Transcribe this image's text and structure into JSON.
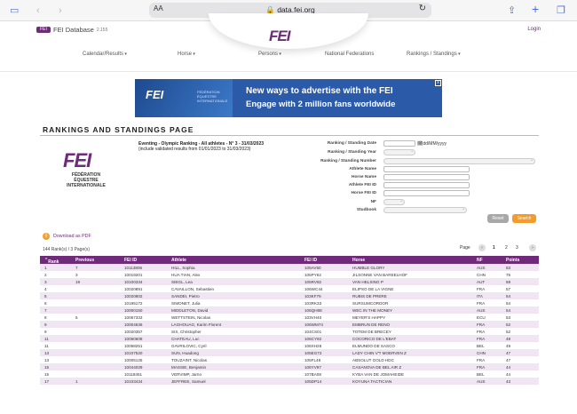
{
  "browser": {
    "aa_label": "AA",
    "url": "data.fei.org"
  },
  "site": {
    "db_tag": "FEI",
    "db_title": "FEI Database",
    "db_beta": "2.155",
    "login": "Login",
    "logo": "FEI",
    "nav": [
      "Calendar/Results",
      "Horse",
      "Persons",
      "National Federations",
      "Rankings / Standings"
    ]
  },
  "banner": {
    "logo": "FEI",
    "sub": "FÉDÉRATION ÉQUESTRE INTERNATIONALE",
    "line1": "New ways to advertise with the FEI",
    "line2": "Engage with 2 million fans worldwide",
    "close": "x"
  },
  "page": {
    "title": "RANKINGS AND STANDINGS PAGE",
    "logo": "FEI",
    "fed_line1": "FÉDÉRATION",
    "fed_line2": "ÉQUESTRE",
    "fed_line3": "INTERNATIONALE",
    "ranking_title": "Eventing - Olympic Ranking - All athletes - N° 3 - 31/03/2023",
    "ranking_sub": "(include validated results from 01/01/2023 to 31/03/2023)"
  },
  "form": {
    "labels": [
      "Ranking / Standing Date",
      "Ranking / Standing Year",
      "Ranking / Standing Number",
      "Athlete Name",
      "Horse Name",
      "Athlete FEI ID",
      "Horse FEI ID",
      "NF",
      "Studbook"
    ],
    "date_format": "dd/MM/yyyy",
    "reset": "Reset",
    "search": "Search"
  },
  "results": {
    "download": "Download as PDF",
    "count": "144 Rank(s) / 3 Page(s)",
    "page_label": "Page",
    "pages": [
      "1",
      "2",
      "3"
    ]
  },
  "table": {
    "headers": [
      "Rank",
      "Previous",
      "FEI ID",
      "Athlete",
      "FEI ID",
      "Horse",
      "NF",
      "Points"
    ],
    "rows": [
      [
        "1",
        "7",
        "10113806",
        "HILL, Sophia",
        "105AV50",
        "HUMBLE GLORY",
        "AUS",
        "83"
      ],
      [
        "2",
        "3",
        "10019201",
        "HUA TIAN, Alex",
        "105PY62",
        "JILSONNE VAN BAREELHOF",
        "CHN",
        "75"
      ],
      [
        "3",
        "19",
        "10100334",
        "SIEGL, Lea",
        "105RV82",
        "VAN HELSING P",
        "AUT",
        "59"
      ],
      [
        "4",
        "",
        "10020891",
        "CAVAILLON, Sebastien",
        "106WC44",
        "ELIPSO DE LA VIGNE",
        "FRA",
        "57"
      ],
      [
        "5",
        "",
        "10020802",
        "SANDEI, Pietro",
        "103KF75",
        "RUBIS DE PRERE",
        "ITA",
        "54"
      ],
      [
        "6",
        "",
        "10195172",
        "SIMONET, Julia",
        "103RK33",
        "SURSUMCORDOR",
        "FRA",
        "54"
      ],
      [
        "7",
        "",
        "10000150",
        "MIDDLETON, David",
        "106QH98",
        "WEC IN THE MONEY",
        "AUS",
        "54"
      ],
      [
        "8",
        "5",
        "10067333",
        "WETTSTEIN, Nicolas",
        "103VH40",
        "MEYER'S HAPPY",
        "ECU",
        "53"
      ],
      [
        "9",
        "",
        "10004636",
        "LAGHOUAG, Karim Florent",
        "106WM74",
        "EMBRUN DE RENO",
        "FRA",
        "52"
      ],
      [
        "9",
        "",
        "10020357",
        "SIX, Christopher",
        "104CS01",
        "TOTEM DE BRECEY",
        "FRA",
        "52"
      ],
      [
        "11",
        "",
        "10060608",
        "CHATEAU, Luc",
        "106CY92",
        "COCORICO DE L'EBAT",
        "FRA",
        "49"
      ],
      [
        "11",
        "",
        "10058251",
        "GAVRILOVIC, Cyril",
        "106XH28",
        "ELMUNDO DE SASCO",
        "BEL",
        "49"
      ],
      [
        "13",
        "",
        "10107520",
        "SUN, Huadong",
        "105EG72",
        "LADY CHIN V'T MOERVEN Z",
        "CHN",
        "47"
      ],
      [
        "13",
        "",
        "10005125",
        "TOUZAINT, Nicolas",
        "105FL48",
        "ABSOLUT GOLD HDC",
        "FRA",
        "47"
      ],
      [
        "15",
        "",
        "10044029",
        "MASSIE, Benjamin",
        "106YV97",
        "CASANOVA DE BEL AIR Z",
        "FRA",
        "44"
      ],
      [
        "15",
        "",
        "10118451",
        "VERVIMP, Jarno",
        "107BA08",
        "KYBA VAN DE JOMAHEIDE",
        "BEL",
        "44"
      ],
      [
        "17",
        "1",
        "10103434",
        "JEFFREE, Samuel",
        "105DP14",
        "KOYUNA TACTICIAN",
        "AUS",
        "43"
      ]
    ]
  }
}
